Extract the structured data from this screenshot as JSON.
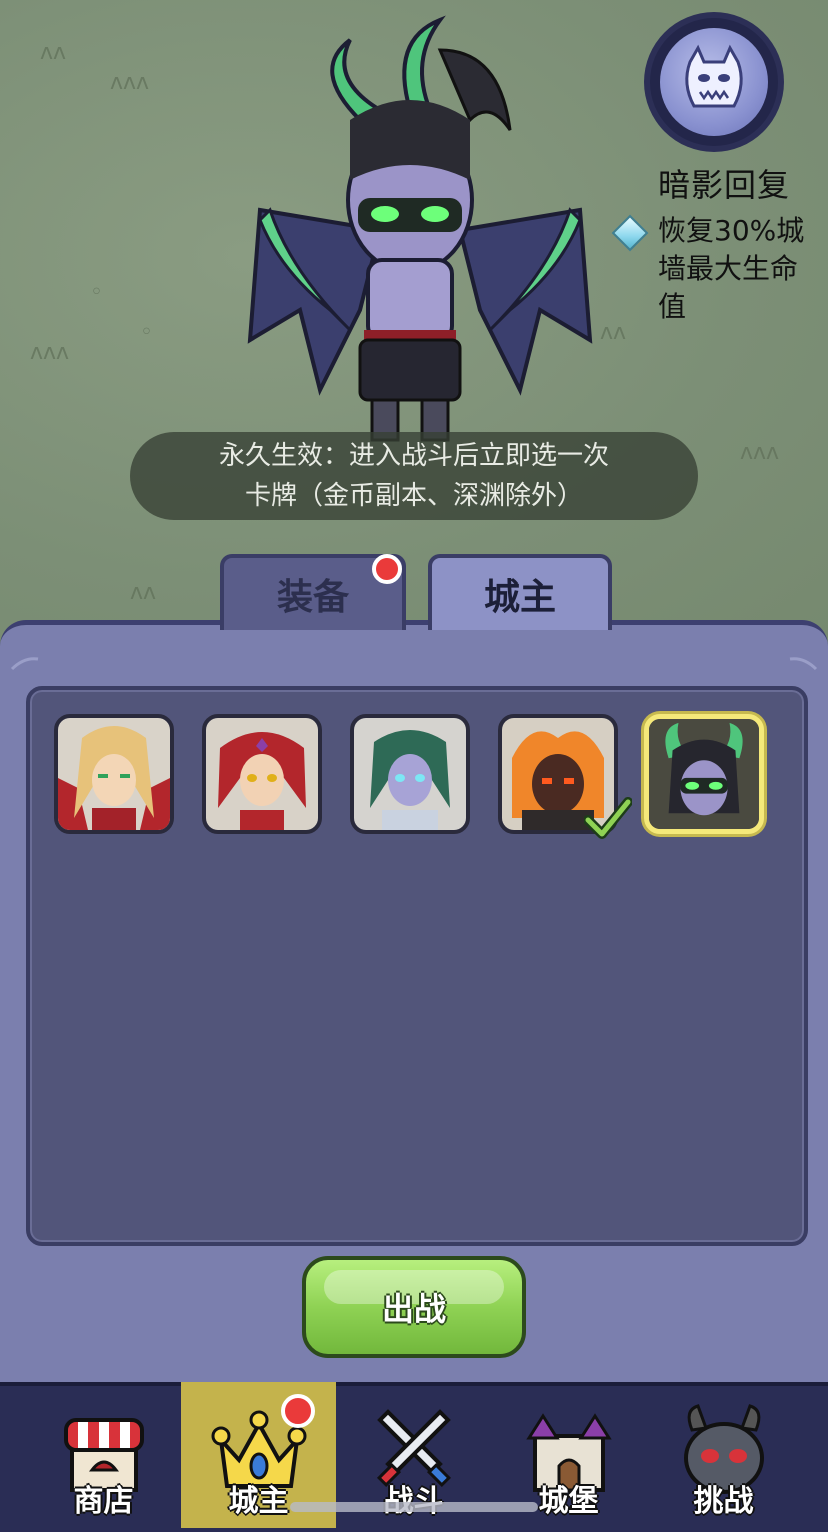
{
  "skill": {
    "icon": "demon-mask-icon",
    "name": "暗影回复",
    "description": "恢复30%城墙最大生命值"
  },
  "effect_banner": {
    "line1": "永久生效：进入战斗后立即选一次",
    "line2": "卡牌（金币副本、深渊除外）"
  },
  "tabs": {
    "equip": {
      "label": "装备",
      "has_notification": true
    },
    "lord": {
      "label": "城主",
      "selected": true
    }
  },
  "lords": [
    {
      "name": "blonde-knight-portrait",
      "selected": false,
      "checked": false
    },
    {
      "name": "red-haired-mage-portrait",
      "selected": false,
      "checked": false
    },
    {
      "name": "green-haired-elf-portrait",
      "selected": false,
      "checked": false
    },
    {
      "name": "fire-demon-portrait",
      "selected": false,
      "checked": true
    },
    {
      "name": "demon-hunter-portrait",
      "selected": true,
      "checked": false
    }
  ],
  "fight_button": {
    "label": "出战"
  },
  "bottom_nav": [
    {
      "label": "商店",
      "icon": "shop-icon",
      "active": false
    },
    {
      "label": "城主",
      "icon": "crown-icon",
      "active": true,
      "has_notification": true
    },
    {
      "label": "战斗",
      "icon": "crossed-swords-icon",
      "active": false
    },
    {
      "label": "城堡",
      "icon": "castle-icon",
      "active": false
    },
    {
      "label": "挑战",
      "icon": "demon-head-icon",
      "active": false
    }
  ],
  "colors": {
    "panel": "#7b7fae",
    "inner_panel": "#52557a",
    "fight_button": "#8fd254",
    "nav_active": "#c4b34c",
    "nav_bg": "#2a2d55",
    "notification": "#ea3a3a"
  }
}
